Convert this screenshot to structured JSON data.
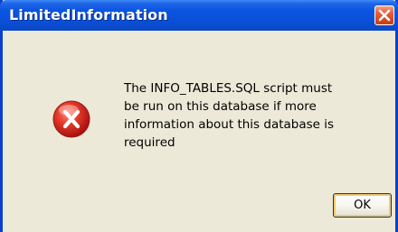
{
  "window": {
    "title": "LimitedInformation",
    "close_icon": "close-icon"
  },
  "content": {
    "icon": "error-icon",
    "message": "The INFO_TABLES.SQL script must\nbe run on this database if more\ninformation about this database is\nrequired"
  },
  "buttons": {
    "ok_label": "OK"
  },
  "colors": {
    "titlebar": "#0a55e0",
    "dialog_background": "#ece9d8",
    "close_button": "#d94a22",
    "error_icon": "#d42020"
  }
}
